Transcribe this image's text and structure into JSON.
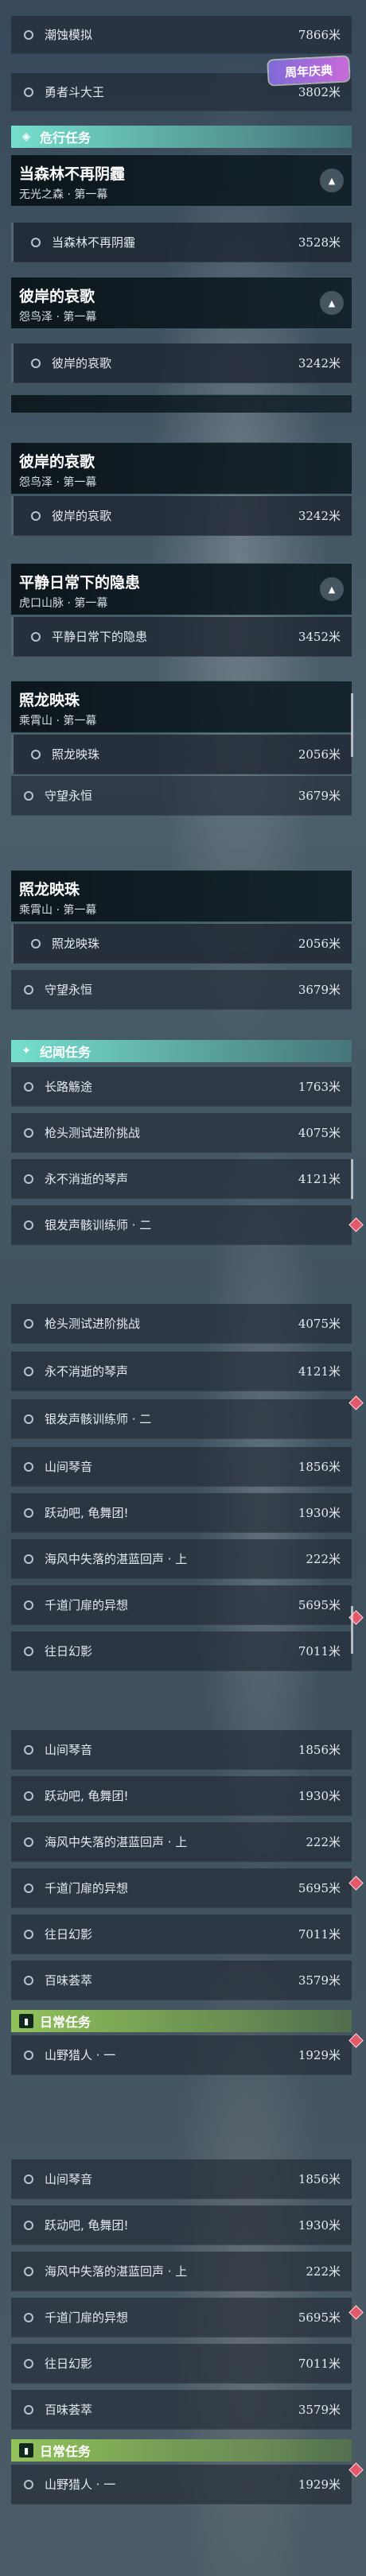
{
  "badge": {
    "text": "周年庆典"
  },
  "segment1": {
    "rows_top": [
      {
        "label": "潮蚀模拟",
        "distance": "7866米"
      },
      {
        "label": "勇者斗大王",
        "distance": "3802米"
      }
    ],
    "header": {
      "title": "危行任务"
    },
    "quest1": {
      "title": "当森林不再阴霾",
      "subtitle": "无光之森 · 第一幕",
      "sub_label": "当森林不再阴霾",
      "sub_distance": "3528米"
    },
    "quest2": {
      "title": "彼岸的哀歌",
      "subtitle": "怨鸟泽 · 第一幕",
      "sub_label": "彼岸的哀歌",
      "sub_distance": "3242米"
    }
  },
  "segment2": {
    "quest1": {
      "title": "彼岸的哀歌",
      "subtitle": "怨鸟泽 · 第一幕",
      "sub_label": "彼岸的哀歌",
      "sub_distance": "3242米"
    },
    "quest2": {
      "title": "平静日常下的隐患",
      "subtitle": "虎口山脉 · 第一幕",
      "sub_label": "平静日常下的隐患",
      "sub_distance": "3452米"
    },
    "quest3": {
      "title": "照龙映珠",
      "subtitle": "乘霄山 · 第一幕",
      "sub_label": "照龙映珠",
      "sub_distance": "2056米"
    },
    "extra": {
      "label": "守望永恒",
      "distance": "3679米"
    }
  },
  "segment3": {
    "quest": {
      "title": "照龙映珠",
      "subtitle": "乘霄山 · 第一幕",
      "sub_label": "照龙映珠",
      "sub_distance": "2056米"
    },
    "extra": {
      "label": "守望永恒",
      "distance": "3679米"
    },
    "header": {
      "title": "纪闻任务"
    },
    "rows": [
      {
        "label": "长路觞途",
        "distance": "1763米"
      },
      {
        "label": "枪头测试进阶挑战",
        "distance": "4075米"
      },
      {
        "label": "永不消逝的琴声",
        "distance": "4121米"
      },
      {
        "label": "银发声骸训练师 · 二",
        "distance": ""
      }
    ]
  },
  "segment4": {
    "rows": [
      {
        "label": "枪头测试进阶挑战",
        "distance": "4075米"
      },
      {
        "label": "永不消逝的琴声",
        "distance": "4121米"
      },
      {
        "label": "银发声骸训练师 · 二",
        "distance": ""
      },
      {
        "label": "山间琴音",
        "distance": "1856米"
      },
      {
        "label": "跃动吧, 龟舞团!",
        "distance": "1930米"
      },
      {
        "label": "海风中失落的湛蓝回声 · 上",
        "distance": "222米"
      },
      {
        "label": "千道门扉的异想",
        "distance": "5695米"
      },
      {
        "label": "往日幻影",
        "distance": "7011米"
      }
    ]
  },
  "segment5": {
    "rows": [
      {
        "label": "山间琴音",
        "distance": "1856米"
      },
      {
        "label": "跃动吧, 龟舞团!",
        "distance": "1930米"
      },
      {
        "label": "海风中失落的湛蓝回声 · 上",
        "distance": "222米"
      },
      {
        "label": "千道门扉的异想",
        "distance": "5695米"
      },
      {
        "label": "往日幻影",
        "distance": "7011米"
      },
      {
        "label": "百味荟萃",
        "distance": "3579米"
      }
    ],
    "header": {
      "title": "日常任务"
    },
    "daily": {
      "label": "山野猎人 · 一",
      "distance": "1929米"
    }
  },
  "segment6": {
    "rows": [
      {
        "label": "山间琴音",
        "distance": "1856米"
      },
      {
        "label": "跃动吧, 龟舞团!",
        "distance": "1930米"
      },
      {
        "label": "海风中失落的湛蓝回声 · 上",
        "distance": "222米"
      },
      {
        "label": "千道门扉的异想",
        "distance": "5695米"
      },
      {
        "label": "往日幻影",
        "distance": "7011米"
      },
      {
        "label": "百味荟萃",
        "distance": "3579米"
      }
    ],
    "header": {
      "title": "日常任务"
    },
    "daily": {
      "label": "山野猎人 · 一",
      "distance": "1929米"
    }
  },
  "colors": {
    "accent_teal": "#78e6d2",
    "accent_green": "#96c85a",
    "marker_red": "#e25a6a"
  }
}
